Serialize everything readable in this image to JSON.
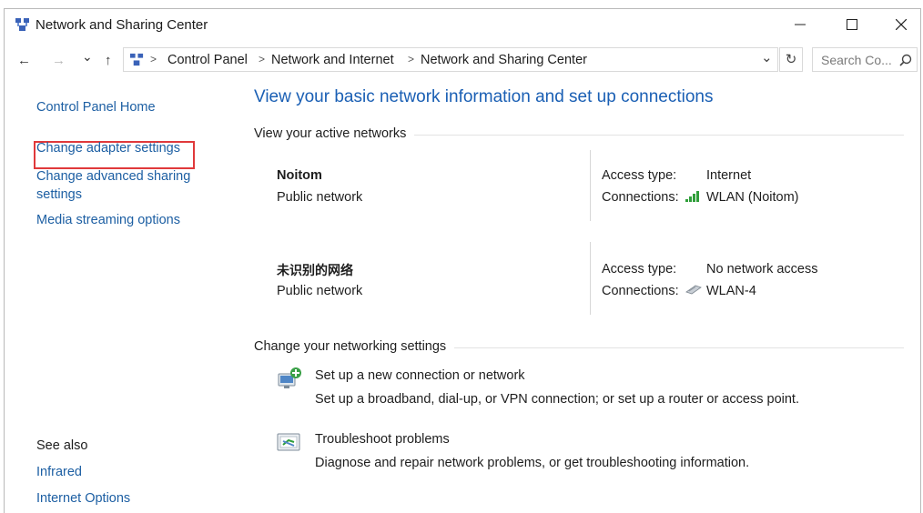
{
  "window": {
    "title": "Network and Sharing Center",
    "controls": {
      "minimize": "—",
      "maximize": "☐",
      "close": "✕"
    }
  },
  "navigation": {
    "back": "←",
    "forward": "→",
    "recent": "⌄",
    "up": "↑",
    "breadcrumbs": [
      "Control Panel",
      "Network and Internet",
      "Network and Sharing Center"
    ],
    "breadcrumb_separator": ">",
    "dropdown": "⌄",
    "refresh": "↻",
    "search_placeholder": "Search Co...",
    "search_icon": "⌕"
  },
  "sidebar": {
    "home": "Control Panel Home",
    "links": [
      "Change adapter settings",
      "Change advanced sharing settings",
      "Media streaming options"
    ],
    "see_also_label": "See also",
    "see_also_links": [
      "Infrared",
      "Internet Options"
    ]
  },
  "main": {
    "heading": "View your basic network information and set up connections",
    "active_networks_label": "View your active networks",
    "networks": [
      {
        "name": "Noitom",
        "category": "Public network",
        "access_label": "Access type:",
        "access_value": "Internet",
        "connections_label": "Connections:",
        "connection_name": "WLAN (Noitom)",
        "icon": "wifi-signal-icon"
      },
      {
        "name": "未识别的网络",
        "category": "Public network",
        "access_label": "Access type:",
        "access_value": "No network access",
        "connections_label": "Connections:",
        "connection_name": "WLAN-4",
        "icon": "network-adapter-icon"
      }
    ],
    "change_settings_label": "Change your networking settings",
    "tasks": [
      {
        "title": "Set up a new connection or network",
        "description": "Set up a broadband, dial-up, or VPN connection; or set up a router or access point.",
        "icon": "new-connection-icon"
      },
      {
        "title": "Troubleshoot problems",
        "description": "Diagnose and repair network problems, or get troubleshooting information.",
        "icon": "troubleshoot-icon"
      }
    ]
  },
  "colors": {
    "link": "#1d5fa3",
    "heading": "#1a5fb4",
    "highlight": "#e0393b"
  }
}
